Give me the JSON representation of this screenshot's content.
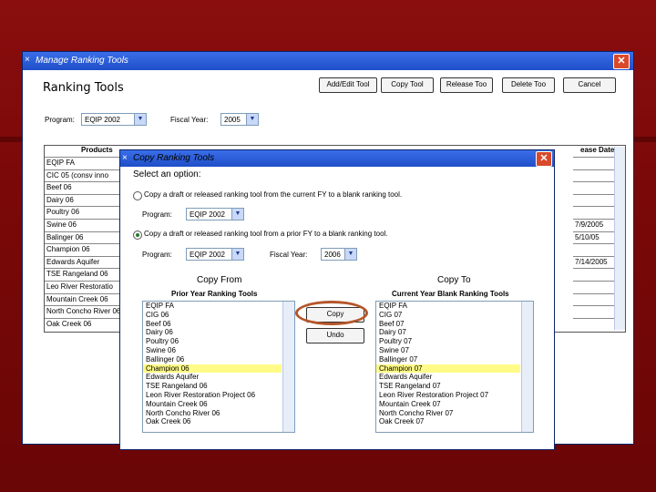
{
  "manage_window": {
    "title": "Manage Ranking Tools",
    "heading": "Ranking Tools",
    "buttons": [
      "Add/Edit Tool",
      "Copy Tool",
      "Release Too",
      "Delete Too",
      "Cancel"
    ],
    "program_label": "Program:",
    "program_value": "EQIP 2002",
    "fiscal_year_label": "Fiscal Year:",
    "fiscal_year_value": "2005",
    "table_header_left": "Products",
    "table_header_right": "ease Date",
    "rows_left": [
      "EQIP FA",
      "CIC 05 (consv inno",
      "Beef 06",
      "Dairy 06",
      "Poultry 06",
      "Swine 06",
      "Balinger 06",
      "Champion 06",
      "Edwards Aquifer",
      "TSE Rangeland 06",
      "Leo River Restoratio",
      "Mountain Creek 06",
      "North Concho River 06",
      "Oak Creek 06"
    ],
    "rows_right": [
      "",
      "",
      "",
      "",
      "",
      "7/9/2005",
      "5/10/05",
      "",
      "7/14/2005",
      "",
      "",
      "",
      "",
      ""
    ]
  },
  "copy_dialog": {
    "title": "Copy Ranking Tools",
    "select_option": "Select an option:",
    "option1_text": "Copy a draft or released ranking tool from the current FY to a blank ranking tool.",
    "option2_text": "Copy a draft or released ranking tool from a prior FY to a blank ranking tool.",
    "program_label": "Program:",
    "program1_value": "EQIP 2002",
    "program2_value": "EQIP 2002",
    "fiscal_year_label": "Fiscal Year:",
    "fiscal_year_value": "2006",
    "copy_from_label": "Copy From",
    "copy_to_label": "Copy To",
    "from_list_header": "Prior Year Ranking Tools",
    "to_list_header": "Current Year Blank Ranking Tools",
    "copy_button": "Copy",
    "undo_button": "Undo",
    "from_items": [
      "EQIP FA",
      "CIG 06",
      "Beef 06",
      "Dairy 06",
      "Poultry 06",
      "Swine 06",
      "Ballinger 06",
      "Champion 06",
      "Edwards Aquifer",
      "TSE Rangeland 06",
      "Leon River Restoration Project 06",
      "Mountain Creek 06",
      "North Concho River 06",
      "Oak Creek 06"
    ],
    "to_items": [
      "EQIP FA",
      "CIG 07",
      "Beef 07",
      "Dairy 07",
      "Poultry 07",
      "Swine 07",
      "Ballinger 07",
      "Champion 07",
      "Edwards Aquifer",
      "TSE Rangeland 07",
      "Leon River Restoration Project 07",
      "Mountain Creek 07",
      "North Concho River 07",
      "Oak Creek 07"
    ],
    "selected_index": 7
  },
  "colors": {
    "titlebar": "#2a5fd8",
    "highlight": "#fffb86",
    "annotation": "#b5562a"
  }
}
